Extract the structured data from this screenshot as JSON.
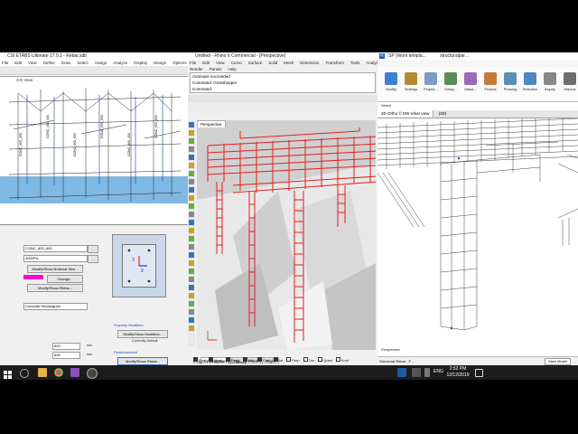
{
  "sap": {
    "title": "CSI ETABS Ultimate 17.0.1 - Rebar.sdb",
    "menu": [
      "File",
      "Edit",
      "View",
      "Define",
      "Draw",
      "Select",
      "Assign",
      "Analyze",
      "Display",
      "Design",
      "Options"
    ],
    "viewport_title": "3-D View",
    "section_name": "CONC_600_600",
    "material": "4000Psi",
    "modify_notional_label": "Modify/Show Notional Size...",
    "change_label": "Change...",
    "modify_rebar_label": "Modify/Show Rebar...",
    "shape": "Concrete Rectangular",
    "property_modifiers_label": "Property Modifiers",
    "modify_modifiers_label": "Modify/Show Modifiers...",
    "currently_default": "Currently Default",
    "reinforcement_label": "Reinforcement",
    "modify_rebar_btn2": "Modify/Show Rebar...",
    "depth_value": "600",
    "width_value": "600",
    "unit_mm": "mm",
    "frame_labels": [
      "CONC_400_400",
      "CONC_400_400",
      "CONC_600_600",
      "CONC_600_600",
      "CONC_400_400",
      "CONC_600_600"
    ],
    "axis_3": "3",
    "axis_2": "2"
  },
  "rhino": {
    "title": "Untitled - Rhino 6 Commercial - [Perspective]",
    "menu": [
      "File",
      "Edit",
      "View",
      "Curve",
      "Surface",
      "Solid",
      "Mesh",
      "Dimension",
      "Transform",
      "Tools",
      "Analyze"
    ],
    "menu2": [
      "Render",
      "Panels",
      "Help"
    ],
    "cmd_history": [
      "Autosave succeeded",
      "Command: Grasshopper"
    ],
    "cmd_prompt": "Command:",
    "tabs": [
      "Select",
      "Viewport Layout",
      "Visibility",
      "Transform",
      "Curve Tools",
      "Surface Tool"
    ],
    "viewport_label": "Perspective",
    "view_tabs": [
      "Perspective",
      "Top",
      "Front",
      "Right"
    ],
    "osnaps": [
      "End",
      "Near",
      "Point",
      "Mid",
      "Cen",
      "Int",
      "Perp",
      "Tan",
      "Quad",
      "Knot"
    ],
    "status": "x 1360.41   y 7465.00   z 0.00   Default"
  },
  "revit": {
    "title": "SP (Work templa...",
    "title2": "structuralpar...",
    "tabs": [
      "File",
      "Architecture",
      "Structure",
      "Steel",
      "Systems",
      "Insert",
      "Annotate"
    ],
    "ribbon": [
      "Modify",
      "Settings",
      "Project...",
      "Desig...",
      "Mana...",
      "Phases",
      "Phasing",
      "Selection",
      "Inquiry",
      "Macros"
    ],
    "select_label": "Select",
    "view_title": "3D Ortho © EW rebar view",
    "view2_title": "(3D)",
    "view_label": "Perspective",
    "status_left": "Structural Rebar : F...",
    "status_model": "Main Model"
  },
  "taskbar": {
    "lang": "ENG",
    "time": "2:52 PM",
    "date": "12/12/2019"
  },
  "colors": {
    "rebar_red": "#e41e1e",
    "revit_blue": "#1f5aa6",
    "etabs_water": "#7fb8e3"
  }
}
